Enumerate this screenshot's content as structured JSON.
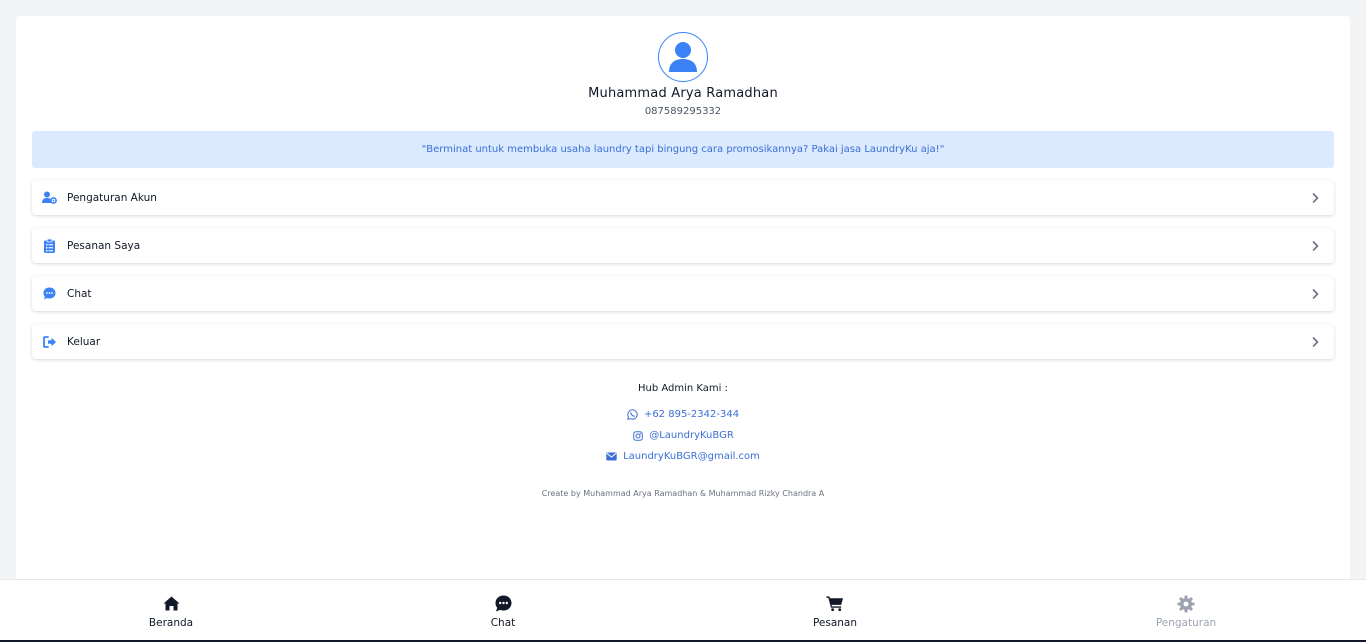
{
  "profile": {
    "name": "Muhammad Arya Ramadhan",
    "phone": "087589295332",
    "avatar_icon": "user-avatar-icon"
  },
  "promo": {
    "text": "\"Berminat untuk membuka usaha laundry tapi bingung cara promosikannya? Pakai jasa LaundryKu aja!\""
  },
  "menu": {
    "items": [
      {
        "label": "Pengaturan Akun",
        "icon": "user-gear-icon"
      },
      {
        "label": "Pesanan Saya",
        "icon": "clipboard-list-icon"
      },
      {
        "label": "Chat",
        "icon": "chat-bubble-icon"
      },
      {
        "label": "Keluar",
        "icon": "logout-icon"
      }
    ]
  },
  "contact": {
    "title": "Hub Admin Kami :",
    "whatsapp": "+62 895-2342-344",
    "instagram": "@LaundryKuBGR",
    "email": "LaundryKuBGR@gmail.com"
  },
  "credits": "Create by Muhammad Arya Ramadhan & Muhammad Rizky Chandra A",
  "nav": {
    "items": [
      {
        "label": "Beranda",
        "icon": "home-icon",
        "active": true
      },
      {
        "label": "Chat",
        "icon": "chat-icon",
        "active": true
      },
      {
        "label": "Pesanan",
        "icon": "cart-icon",
        "active": true
      },
      {
        "label": "Pengaturan",
        "icon": "gear-icon",
        "active": false
      }
    ]
  },
  "colors": {
    "accent": "#3b82f6",
    "promo_bg": "#dbeafe",
    "link": "#3b6fd6",
    "inactive_nav": "#9ca3af"
  }
}
